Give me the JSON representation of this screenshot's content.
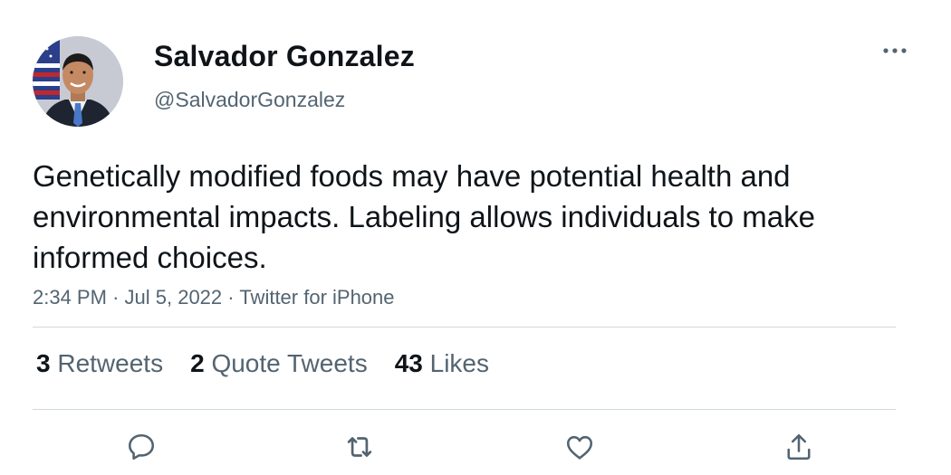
{
  "author": {
    "name": "Salvador Gonzalez",
    "handle": "@SalvadorGonzalez"
  },
  "tweet": {
    "text": "Genetically modified foods may have potential health and environmental impacts. Labeling allows individuals to make informed choices.",
    "time": "2:34 PM",
    "date": "Jul 5, 2022",
    "source": "Twitter for iPhone",
    "separator": "·"
  },
  "stats": {
    "retweets_count": "3",
    "retweets_label": "Retweets",
    "quotes_count": "2",
    "quotes_label": "Quote Tweets",
    "likes_count": "43",
    "likes_label": "Likes"
  },
  "icons": {
    "more": "more-options-icon",
    "reply": "reply-icon",
    "retweet": "retweet-icon",
    "like": "heart-icon",
    "share": "share-icon"
  },
  "colors": {
    "text_primary": "#0f1419",
    "text_secondary": "#536471",
    "divider": "#cfd9de"
  }
}
